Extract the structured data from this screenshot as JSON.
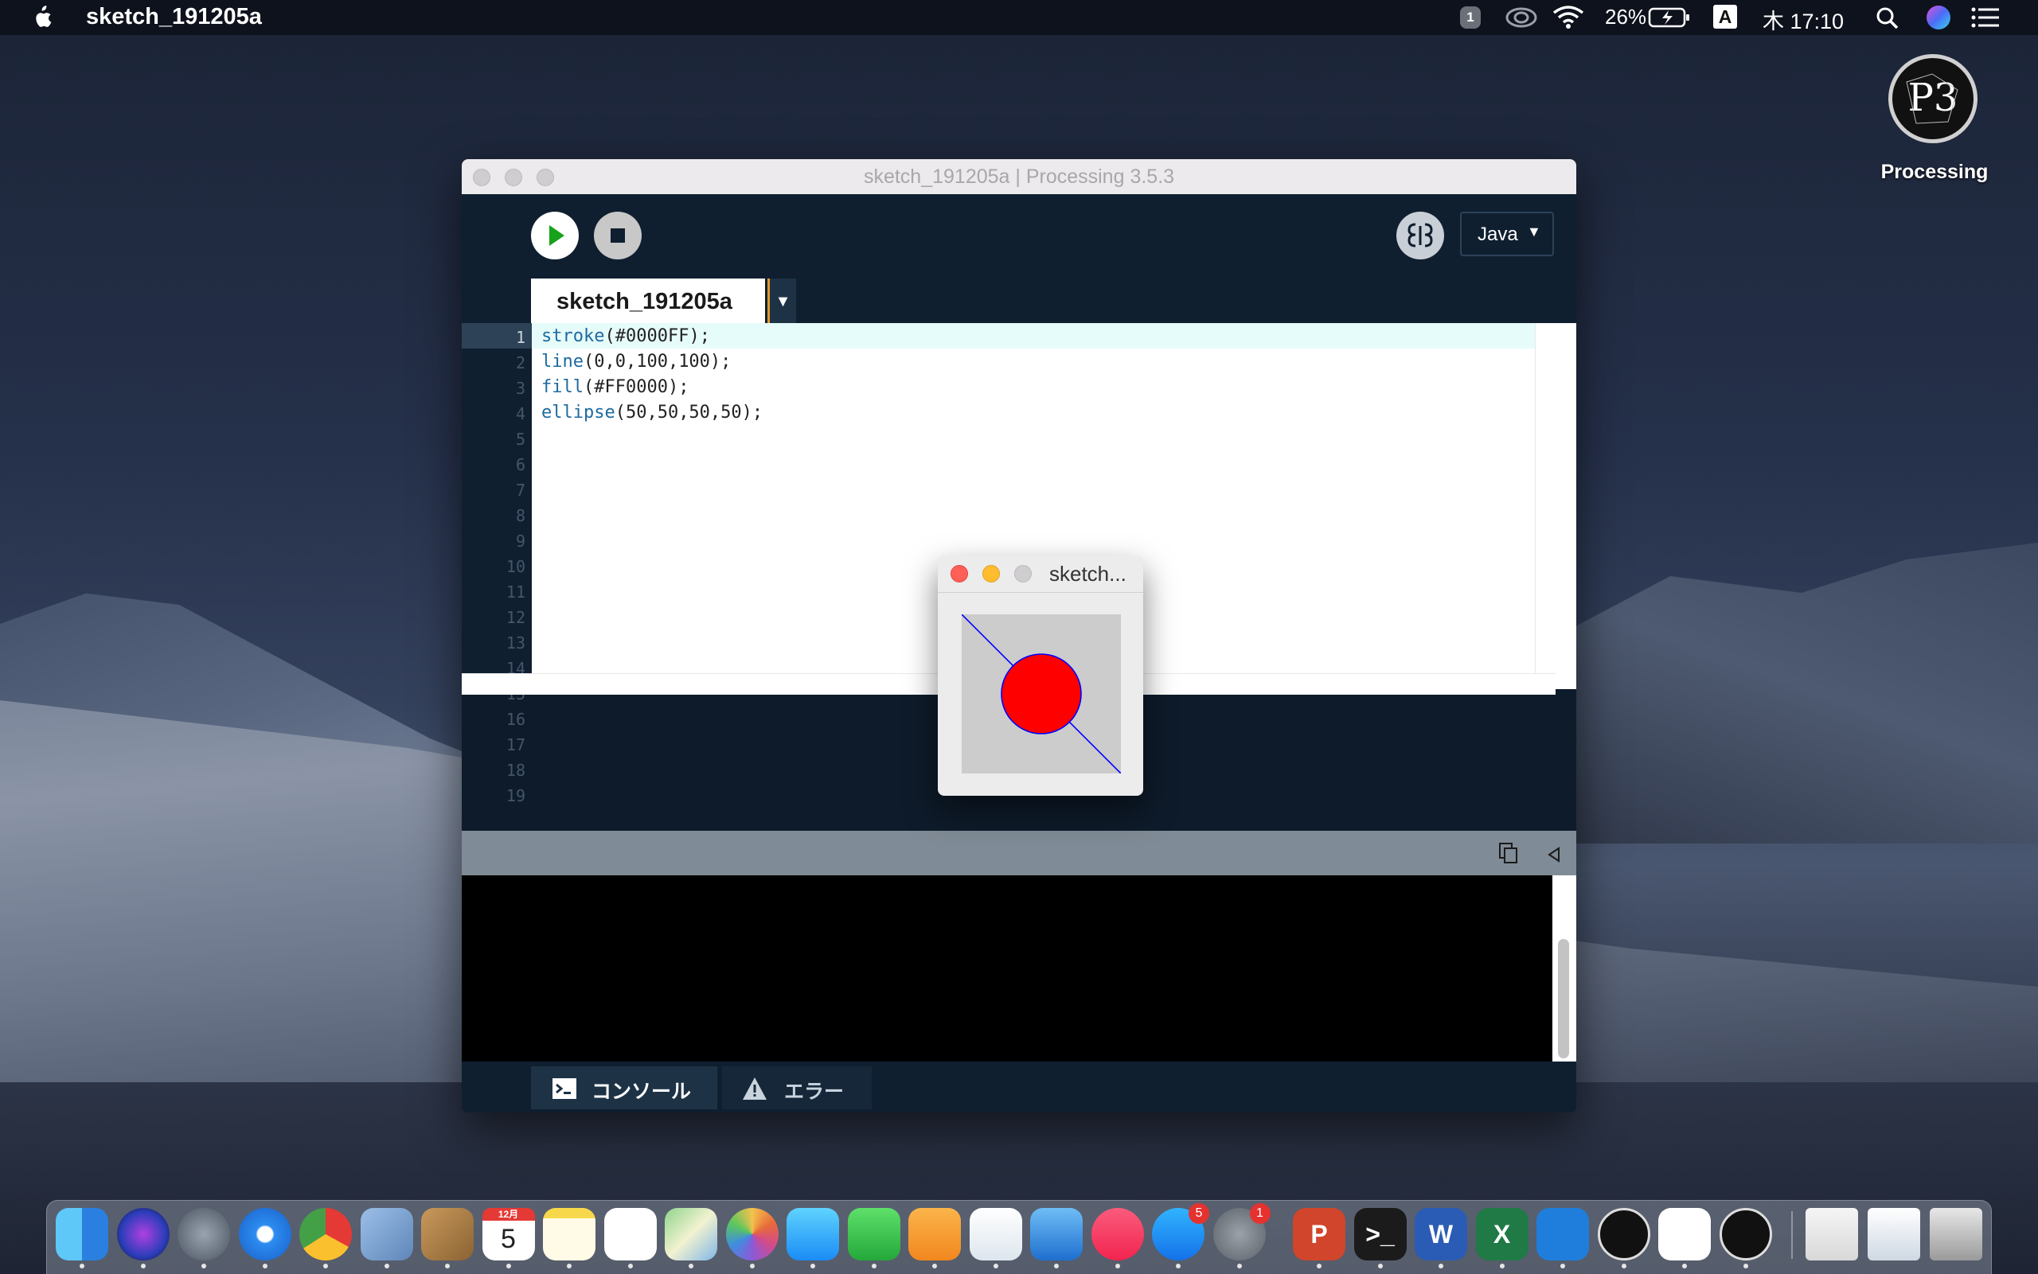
{
  "menubar": {
    "app_name": "sketch_191205a",
    "notification_count": "1",
    "battery_percent": "26%",
    "input_source": "A",
    "clock": "木 17:10"
  },
  "desktop": {
    "icon_label": "Processing"
  },
  "window": {
    "title": "sketch_191205a | Processing 3.5.3",
    "mode": "Java",
    "tab_name": "sketch_191205a",
    "code_lines": [
      {
        "fn": "stroke",
        "args": "(#0000FF);"
      },
      {
        "fn": "line",
        "args": "(0,0,100,100);"
      },
      {
        "fn": "fill",
        "args": "(#FF0000);"
      },
      {
        "fn": "ellipse",
        "args": "(50,50,50,50);"
      }
    ],
    "line_numbers": [
      "1",
      "2",
      "3",
      "4",
      "5",
      "6",
      "7",
      "8",
      "9",
      "10",
      "11",
      "12",
      "13",
      "14",
      "15",
      "16",
      "17",
      "18",
      "19"
    ],
    "console_tab": "コンソール",
    "errors_tab": "エラー"
  },
  "sketch_window": {
    "title": "sketch...",
    "stroke_color": "#0000FF",
    "fill_color": "#FF0000",
    "background_color": "#CCCCCC"
  },
  "dock": {
    "apps": [
      {
        "name": "Finder",
        "icon": "finder-icon"
      },
      {
        "name": "Siri",
        "icon": "siri-icon"
      },
      {
        "name": "Launchpad",
        "icon": "launchpad-icon"
      },
      {
        "name": "Safari",
        "icon": "safari-icon"
      },
      {
        "name": "Chrome",
        "icon": "chrome-icon"
      },
      {
        "name": "Preview",
        "icon": "preview-icon"
      },
      {
        "name": "Contacts",
        "icon": "contacts-icon"
      },
      {
        "name": "Calendar",
        "icon": "calendar-icon",
        "month": "12月",
        "day": "5"
      },
      {
        "name": "Notes",
        "icon": "notes-icon"
      },
      {
        "name": "Reminders",
        "icon": "reminders-icon"
      },
      {
        "name": "Maps",
        "icon": "maps-icon"
      },
      {
        "name": "Photos",
        "icon": "photos-icon"
      },
      {
        "name": "Messages",
        "icon": "messages-icon"
      },
      {
        "name": "FaceTime",
        "icon": "facetime-icon"
      },
      {
        "name": "Pages",
        "icon": "pages-icon"
      },
      {
        "name": "Numbers",
        "icon": "numbers-icon"
      },
      {
        "name": "Keynote",
        "icon": "keynote-icon"
      },
      {
        "name": "Music",
        "icon": "music-icon"
      },
      {
        "name": "App Store",
        "icon": "appstore-icon",
        "badge": "5"
      },
      {
        "name": "System Preferences",
        "icon": "system-preferences-icon",
        "badge": "1"
      },
      {
        "name": "PowerPoint",
        "icon": "powerpoint-icon",
        "letter": "P"
      },
      {
        "name": "Terminal",
        "icon": "terminal-icon",
        "letter": ">_"
      },
      {
        "name": "Word",
        "icon": "word-icon",
        "letter": "W"
      },
      {
        "name": "Excel",
        "icon": "excel-icon",
        "letter": "X"
      },
      {
        "name": "Box",
        "icon": "box-icon"
      },
      {
        "name": "Processing",
        "icon": "processing-icon"
      },
      {
        "name": "Slack",
        "icon": "slack-icon"
      },
      {
        "name": "Processing Sketch",
        "icon": "sketch-runner-icon"
      }
    ]
  }
}
